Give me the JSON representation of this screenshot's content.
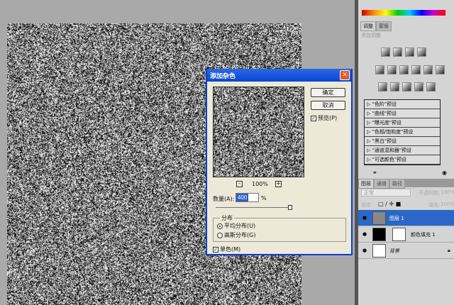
{
  "dialog": {
    "title": "添加杂色",
    "ok": "确定",
    "cancel": "取消",
    "preview": "预览(P)",
    "preview_checked": true,
    "zoom": "100%",
    "zoom_out": "-",
    "zoom_in": "+",
    "amount_label": "数量(A):",
    "amount_value": "400",
    "amount_unit": "%",
    "amount_slider": 1.0,
    "distribution_label": "分布",
    "uniform": "平均分布(U)",
    "gaussian": "高斯分布(G)",
    "selected_distribution": "uniform",
    "mono": "单色(M)",
    "mono_checked": true
  },
  "adjust_panel": {
    "tabs": [
      "调整",
      "蒙版"
    ],
    "header": "添加调整",
    "presets": [
      "\"色阶\"预设",
      "\"曲线\"预设",
      "\"曝光度\"预设",
      "\"色相/饱和度\"预设",
      "\"黑白\"预设",
      "\"通道混和器\"预设",
      "\"可选颜色\"预设"
    ]
  },
  "layers_panel": {
    "tabs": [
      "图层",
      "通道",
      "路径"
    ],
    "blend_mode": "正常",
    "opacity_label": "不透明度:",
    "opacity": "100%",
    "lock_label": "锁定:",
    "fill_label": "填充:",
    "fill": "100%",
    "layers": [
      {
        "name": "图层 1",
        "selected": true
      },
      {
        "name": "颜色填充 1",
        "selected": false
      },
      {
        "name": "背景",
        "selected": false
      }
    ]
  },
  "colors": {
    "title_bar": "#0846d0",
    "selected_layer": "#2b67c6"
  }
}
